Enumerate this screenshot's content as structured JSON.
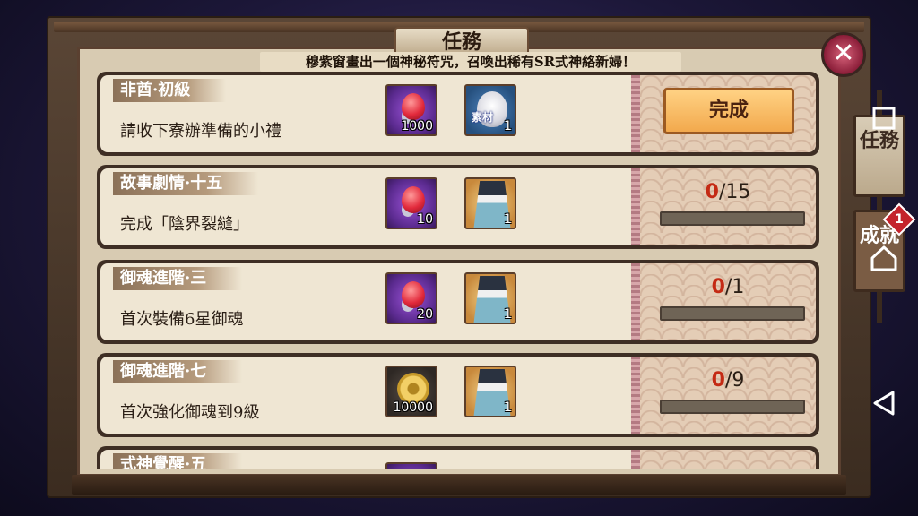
{
  "window": {
    "title": "任務",
    "subtitle": "穆紫窗畫出一個神秘符咒，召喚出稀有SR式神絡新婦！",
    "close_icon": "close-icon"
  },
  "tasks": [
    {
      "name": "非酋·初級",
      "desc": "請收下寮辦準備的小禮",
      "rewards": [
        {
          "icon": "red-orb-icon",
          "count": "1000"
        },
        {
          "icon": "daruma-material-icon",
          "tag": "素材",
          "count": "1"
        }
      ],
      "status": "complete",
      "complete_label": "完成"
    },
    {
      "name": "故事劇情·十五",
      "desc": "完成「陰界裂縫」",
      "rewards": [
        {
          "icon": "red-orb-icon",
          "count": "10"
        },
        {
          "icon": "shikigami-card-icon",
          "count": "1"
        }
      ],
      "status": "progress",
      "current": "0",
      "total": "/15",
      "fraction": 0
    },
    {
      "name": "御魂進階·三",
      "desc": "首次裝備6星御魂",
      "rewards": [
        {
          "icon": "red-orb-icon",
          "count": "20"
        },
        {
          "icon": "shikigami-card-icon",
          "count": "1"
        }
      ],
      "status": "progress",
      "current": "0",
      "total": "/1",
      "fraction": 0
    },
    {
      "name": "御魂進階·七",
      "desc": "首次強化御魂到9級",
      "rewards": [
        {
          "icon": "gold-coin-icon",
          "count": "10000"
        },
        {
          "icon": "shikigami-card-icon",
          "count": "1"
        }
      ],
      "status": "progress",
      "current": "0",
      "total": "/9",
      "fraction": 0
    },
    {
      "name": "式神覺醒·五"
    }
  ],
  "side_tabs": [
    {
      "label": "任務",
      "active": false
    },
    {
      "label": "成就",
      "active": true,
      "badge": "1"
    }
  ],
  "colors": {
    "accent": "#f2a94d",
    "progress_current": "#c42a14",
    "badge": "#c4232c"
  }
}
